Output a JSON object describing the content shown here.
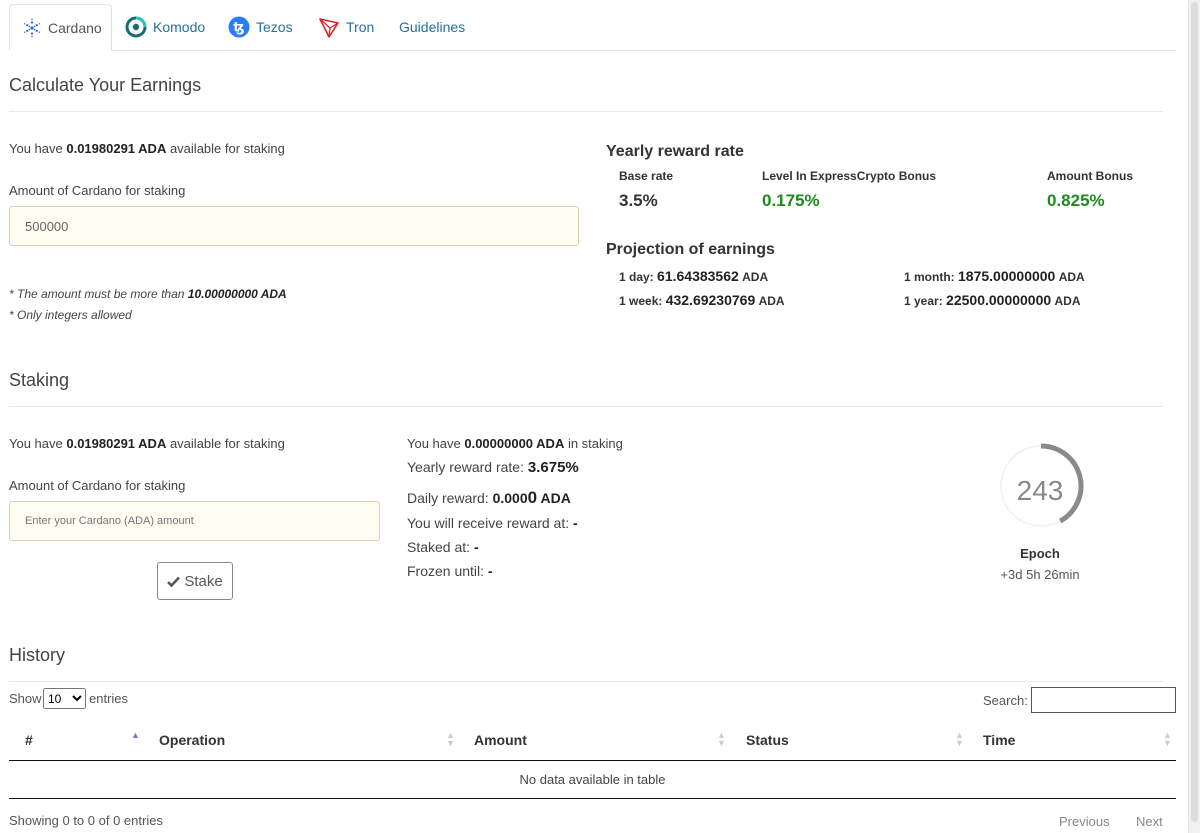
{
  "tabs": [
    {
      "label": "Cardano",
      "icon": "cardano-icon"
    },
    {
      "label": "Komodo",
      "icon": "komodo-icon"
    },
    {
      "label": "Tezos",
      "icon": "tezos-icon"
    },
    {
      "label": "Tron",
      "icon": "tron-icon"
    },
    {
      "label": "Guidelines"
    }
  ],
  "calc": {
    "heading": "Calculate Your Earnings",
    "avail_pre": "You have ",
    "avail_amount": "0.01980291 ADA",
    "avail_post": " available for staking",
    "amount_label": "Amount of Cardano for staking",
    "amount_value": "500000",
    "note1_pre": "* The amount must be more than ",
    "note1_amount": "10.00000000 ADA",
    "note2": "* Only integers allowed"
  },
  "rates": {
    "title": "Yearly reward rate",
    "base_label": "Base rate",
    "base_value": "3.5%",
    "level_label": "Level In ExpressCrypto Bonus",
    "level_value": "0.175%",
    "amount_label": "Amount Bonus",
    "amount_value": "0.825%",
    "accent": "#1e8a1e"
  },
  "projection": {
    "title": "Projection of earnings",
    "day_label": "1 day:",
    "day_value": "61.64383562",
    "week_label": "1 week:",
    "week_value": "432.69230769",
    "month_label": "1 month:",
    "month_value": "1875.00000000",
    "year_label": "1 year:",
    "year_value": "22500.00000000",
    "unit": "ADA"
  },
  "staking": {
    "heading": "Staking",
    "avail_pre": "You have ",
    "avail_amount": "0.01980291 ADA",
    "avail_post": " available for staking",
    "amount_label": "Amount of Cardano for staking",
    "amount_placeholder": "Enter your Cardano (ADA) amount",
    "stake_button": "Stake",
    "instake_pre": "You have ",
    "instake_amount": "0.00000000 ADA",
    "instake_post": " in staking",
    "yearly_label": "Yearly reward rate: ",
    "yearly_value": "3.675%",
    "daily_label": "Daily reward: ",
    "daily_value_a": "0.000",
    "daily_value_b": "0",
    "daily_unit": " ADA",
    "receive_label": "You will receive reward at: ",
    "receive_value": "-",
    "staked_label": "Staked at: ",
    "staked_value": "-",
    "frozen_label": "Frozen until: ",
    "frozen_value": "-"
  },
  "epoch": {
    "number": "243",
    "label": "Epoch",
    "remaining": "+3d 5h 26min",
    "progress": 0.42,
    "color": "#8a8a8a"
  },
  "history": {
    "heading": "History",
    "show_pre": "Show",
    "show_value": "10",
    "show_post": "entries",
    "search_label": "Search:",
    "columns": [
      "#",
      "Operation",
      "Amount",
      "Status",
      "Time"
    ],
    "empty_text": "No data available in table",
    "info": "Showing 0 to 0 of 0 entries",
    "prev": "Previous",
    "next": "Next"
  }
}
